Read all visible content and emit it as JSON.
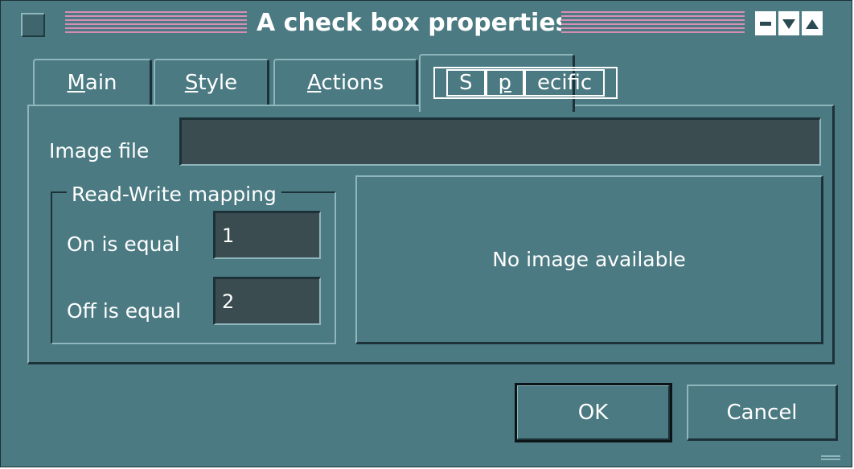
{
  "window": {
    "title": "A check box properties",
    "controls": {
      "system_menu": "system-menu-icon",
      "minimize": "minimize-icon",
      "maximize": "maximize-icon",
      "restore": "restore-icon"
    }
  },
  "tabs": [
    {
      "label": "Main",
      "mnemonic": "M",
      "rest": "ain"
    },
    {
      "label": "Style",
      "mnemonic": "S",
      "rest": "tyle"
    },
    {
      "label": "Actions",
      "mnemonic": "A",
      "rest": "ctions"
    },
    {
      "label": "Specific",
      "mnemonic": "p",
      "pre": "S",
      "rest": "ecific",
      "selected": true
    }
  ],
  "specific": {
    "image_file_label": "Image file",
    "image_file_value": "",
    "mapping_group_title": "Read-Write mapping",
    "on_label": "On is equal",
    "on_value": "1",
    "off_label": "Off is equal",
    "off_value": "2",
    "preview_text": "No image available"
  },
  "buttons": {
    "ok": "OK",
    "cancel": "Cancel"
  },
  "colors": {
    "background": "#4b7a82",
    "field": "#3a4c4f",
    "title_stripes": "#d68fb3",
    "text": "#ffffff"
  }
}
